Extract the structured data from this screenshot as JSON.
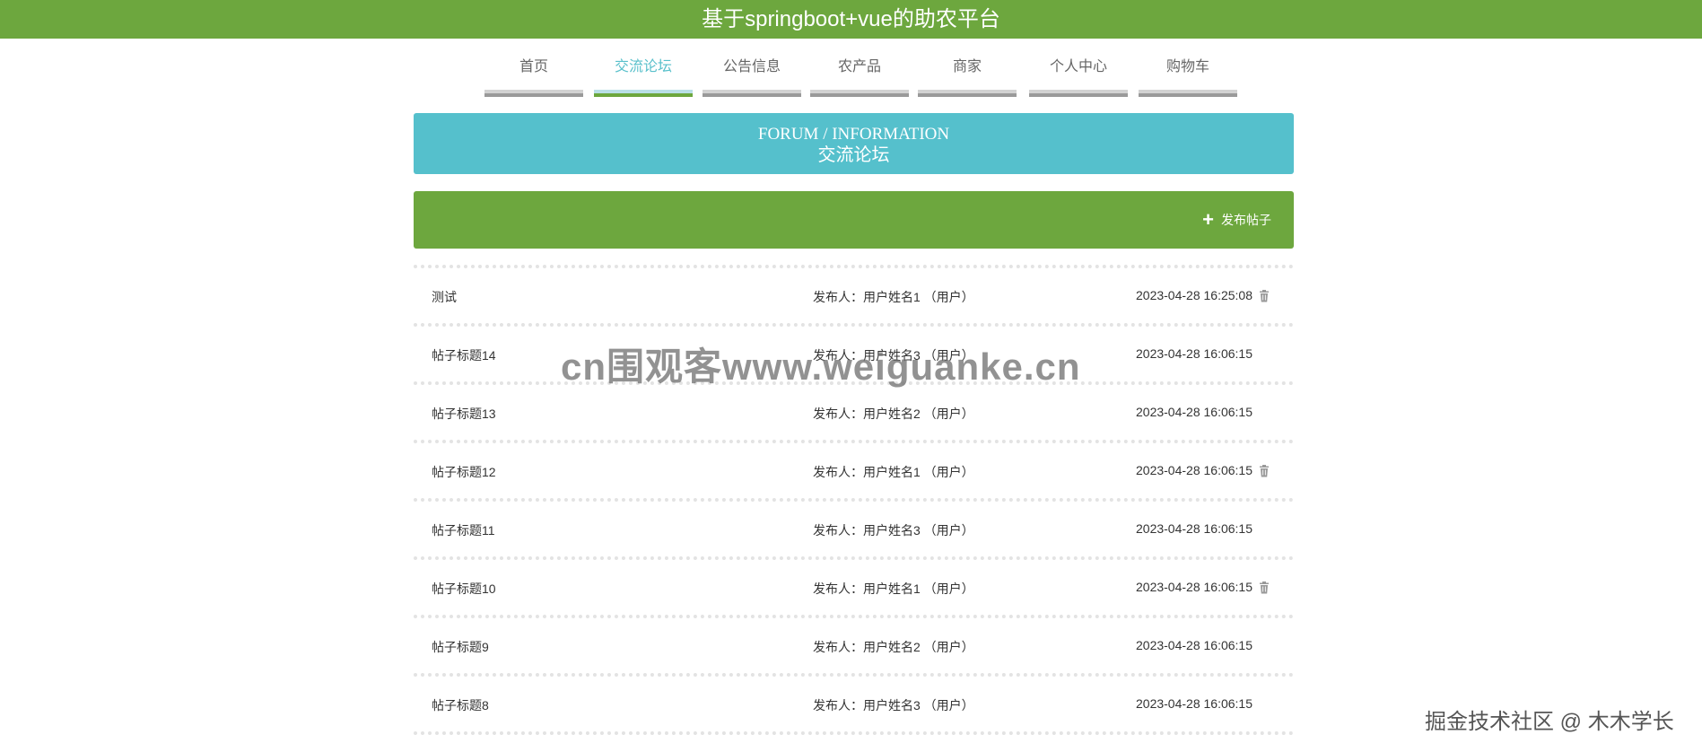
{
  "header": {
    "title": "基于springboot+vue的助农平台"
  },
  "nav": {
    "items": [
      {
        "label": "首页",
        "active": false
      },
      {
        "label": "交流论坛",
        "active": true
      },
      {
        "label": "公告信息",
        "active": false
      },
      {
        "label": "农产品",
        "active": false
      },
      {
        "label": "商家",
        "active": false
      },
      {
        "label": "个人中心",
        "active": false
      },
      {
        "label": "购物车",
        "active": false
      }
    ]
  },
  "banner": {
    "english": "FORUM / INFORMATION",
    "chinese": "交流论坛"
  },
  "actions": {
    "publish_label": "发布帖子",
    "publish_icon": "plus-icon"
  },
  "posts": [
    {
      "title": "测试",
      "author": "发布人：用户姓名1 （用户）",
      "time": "2023-04-28 16:25:08",
      "deletable": true
    },
    {
      "title": "帖子标题14",
      "author": "发布人：用户姓名3 （用户）",
      "time": "2023-04-28 16:06:15",
      "deletable": false
    },
    {
      "title": "帖子标题13",
      "author": "发布人：用户姓名2 （用户）",
      "time": "2023-04-28 16:06:15",
      "deletable": false
    },
    {
      "title": "帖子标题12",
      "author": "发布人：用户姓名1 （用户）",
      "time": "2023-04-28 16:06:15",
      "deletable": true
    },
    {
      "title": "帖子标题11",
      "author": "发布人：用户姓名3 （用户）",
      "time": "2023-04-28 16:06:15",
      "deletable": false
    },
    {
      "title": "帖子标题10",
      "author": "发布人：用户姓名1 （用户）",
      "time": "2023-04-28 16:06:15",
      "deletable": true
    },
    {
      "title": "帖子标题9",
      "author": "发布人：用户姓名2 （用户）",
      "time": "2023-04-28 16:06:15",
      "deletable": false
    },
    {
      "title": "帖子标题8",
      "author": "发布人：用户姓名3 （用户）",
      "time": "2023-04-28 16:06:15",
      "deletable": false
    }
  ],
  "overlay": {
    "watermark": "cn围观客www.weiguanke.cn",
    "credit": "掘金技术社区 @ 木木学长"
  },
  "colors": {
    "brand_green": "#6da73e",
    "banner_teal": "#55c0cc",
    "active_nav_text": "#59c0cb"
  }
}
